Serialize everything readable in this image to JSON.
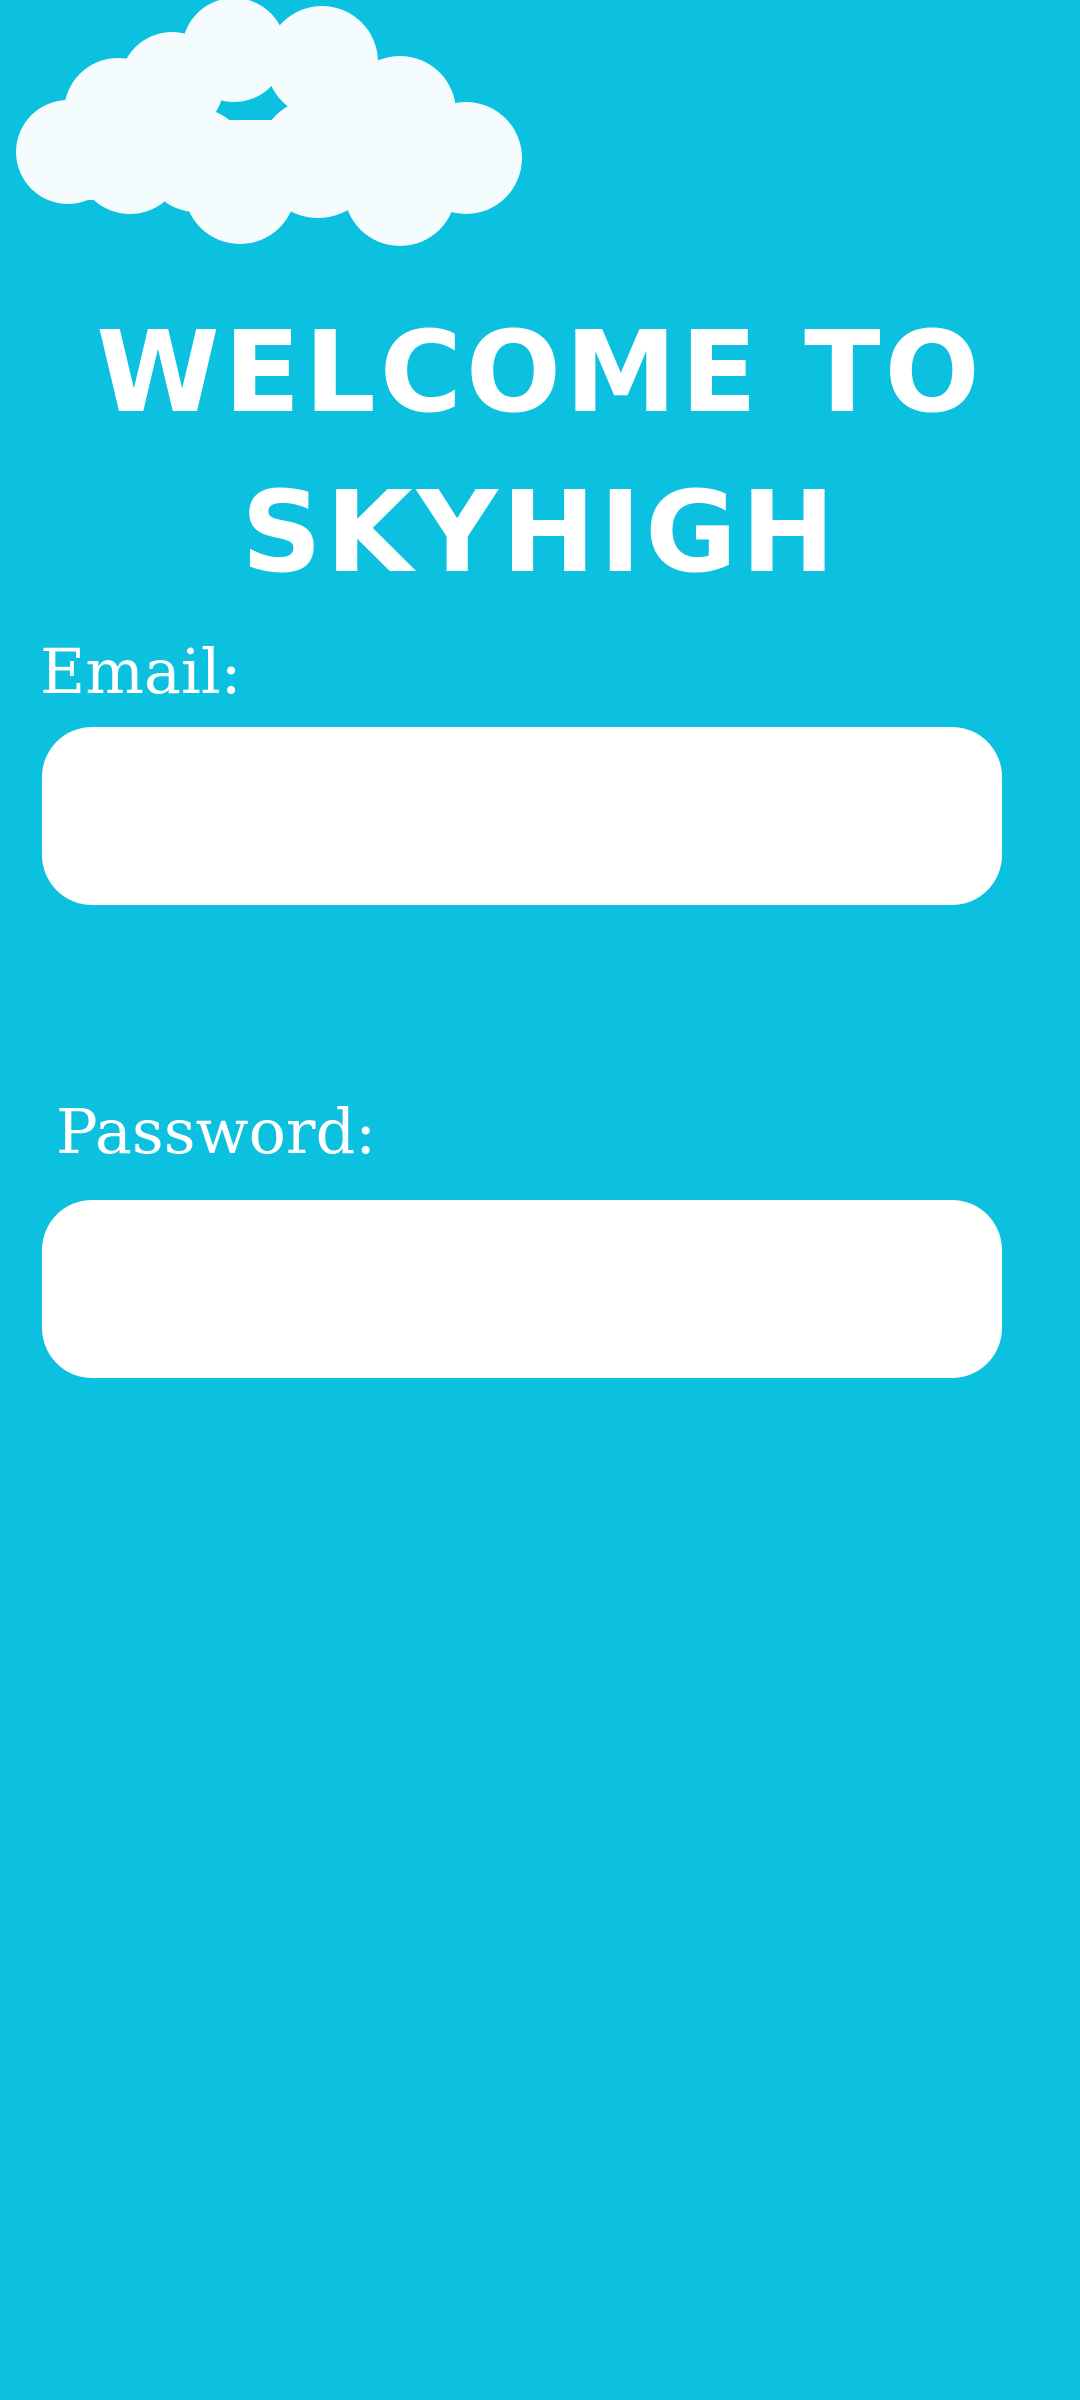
{
  "colors": {
    "background": "#0cc0df",
    "cloud": "#f5fcfe",
    "text": "#ffffff",
    "field": "#ffffff"
  },
  "decoration": {
    "cloud_icon": "cloud-icon"
  },
  "header": {
    "title_line1": "WELCOME TO",
    "title_line2": "SKYHIGH"
  },
  "form": {
    "email_label": "Email:",
    "email_value": "",
    "password_label": "Password:",
    "password_value": ""
  }
}
